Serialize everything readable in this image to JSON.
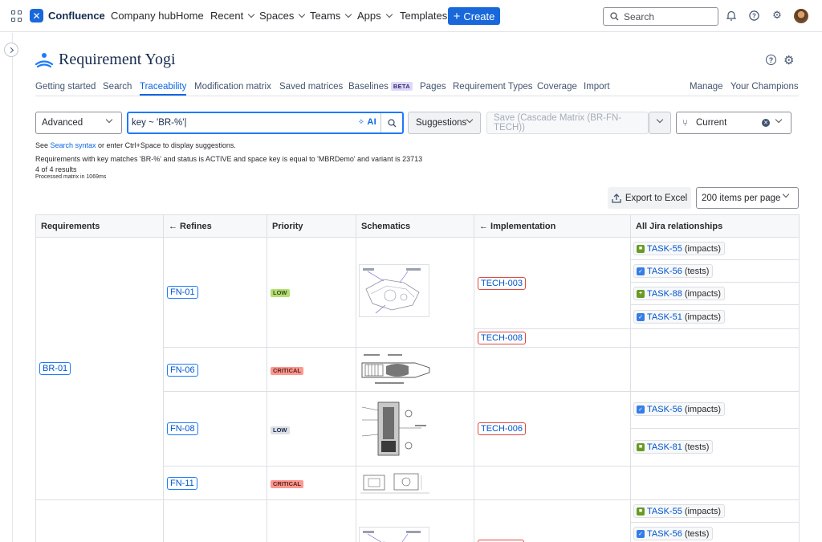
{
  "topnav": {
    "brand": "Confluence",
    "items": [
      "Company hub",
      "Home",
      "Recent",
      "Spaces",
      "Teams",
      "Apps",
      "Templates"
    ],
    "create_label": "Create",
    "search_placeholder": "Search"
  },
  "app": {
    "title": "Requirement Yogi",
    "tabs": [
      "Getting started",
      "Search",
      "Traceability",
      "Modification matrix",
      "Saved matrices",
      "Baselines",
      "Pages",
      "Requirement Types",
      "Coverage",
      "Import"
    ],
    "beta_badge": "BETA",
    "active_tab": "Traceability",
    "right_tabs": [
      "Manage",
      "Your Champions"
    ]
  },
  "query": {
    "mode": "Advanced",
    "text": "key ~ 'BR-%'",
    "ai_label": "AI",
    "suggestions_label": "Suggestions",
    "save_label": "Save (Cascade Matrix (BR-FN-TECH))",
    "version_label": "Current"
  },
  "hint": {
    "prefix": "See ",
    "link": "Search syntax",
    "suffix": " or enter Ctrl+Space to display suggestions."
  },
  "results": {
    "summary": "Requirements with key matches 'BR-%' and status is ACTIVE and space key is equal to 'MBRDemo' and variant is 23713",
    "count": "4 of 4 results",
    "processed": "Processed matrix in 1069ms"
  },
  "toolbar": {
    "export_label": "Export to Excel",
    "per_page": "200 items per page"
  },
  "table": {
    "headers": [
      "Requirements",
      "← Refines",
      "Priority",
      "Schematics",
      "← Implementation",
      "All Jira relationships"
    ],
    "requirement": "BR-01",
    "rows": [
      {
        "refine": "FN-01",
        "priority": "LOW",
        "impl": [
          "TECH-003",
          "TECH-008"
        ]
      },
      {
        "refine": "FN-06",
        "priority": "CRITICAL"
      },
      {
        "refine": "FN-08",
        "priority": "LOW",
        "impl": [
          "TECH-006"
        ]
      },
      {
        "refine": "FN-11",
        "priority": "CRITICAL"
      }
    ],
    "jira": [
      {
        "key": "TASK-55",
        "rel": "(impacts)",
        "type": "story"
      },
      {
        "key": "TASK-56",
        "rel": "(tests)",
        "type": "task"
      },
      {
        "key": "TASK-88",
        "rel": "(impacts)",
        "type": "story"
      },
      {
        "key": "TASK-51",
        "rel": "(impacts)",
        "type": "task"
      },
      {
        "key": "TASK-56",
        "rel": "(impacts)",
        "type": "task"
      },
      {
        "key": "TASK-81",
        "rel": "(tests)",
        "type": "story"
      },
      {
        "key": "TASK-55",
        "rel": "(impacts)",
        "type": "story"
      },
      {
        "key": "TASK-56",
        "rel": "(tests)",
        "type": "task"
      }
    ]
  }
}
